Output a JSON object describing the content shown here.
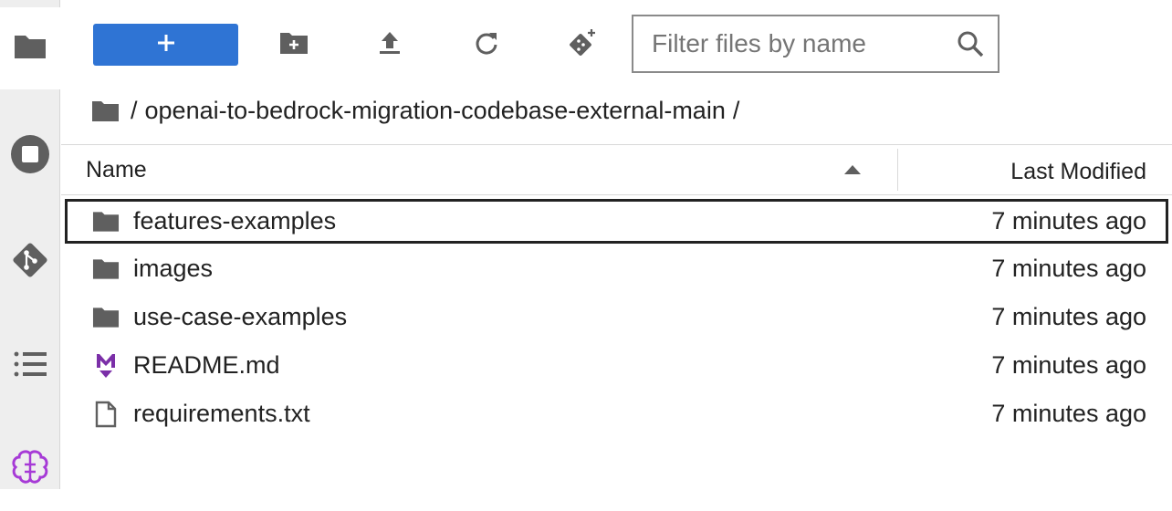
{
  "toolbar": {
    "new_label": "+",
    "filter_placeholder": "Filter files by name"
  },
  "breadcrumb": {
    "separator_start": "/",
    "path": "openai-to-bedrock-migration-codebase-external-main",
    "separator_end": "/"
  },
  "listing": {
    "columns": {
      "name": "Name",
      "modified": "Last Modified"
    },
    "sort": "name-ascending",
    "rows": [
      {
        "icon": "folder-icon",
        "name": "features-examples",
        "modified": "7 minutes ago",
        "selected": true
      },
      {
        "icon": "folder-icon",
        "name": "images",
        "modified": "7 minutes ago"
      },
      {
        "icon": "folder-icon",
        "name": "use-case-examples",
        "modified": "7 minutes ago"
      },
      {
        "icon": "markdown-icon",
        "name": "README.md",
        "modified": "7 minutes ago"
      },
      {
        "icon": "file-icon",
        "name": "requirements.txt",
        "modified": "7 minutes ago"
      }
    ]
  },
  "sidebar": {
    "items": [
      "file-browser-icon",
      "running-terminals-icon",
      "git-icon",
      "table-of-contents-icon",
      "ai-assistant-icon"
    ]
  },
  "colors": {
    "accent": "#2f74d4",
    "markdown": "#7b2fa8",
    "ai": "#a63ad6",
    "icon": "#5f5f5f"
  }
}
